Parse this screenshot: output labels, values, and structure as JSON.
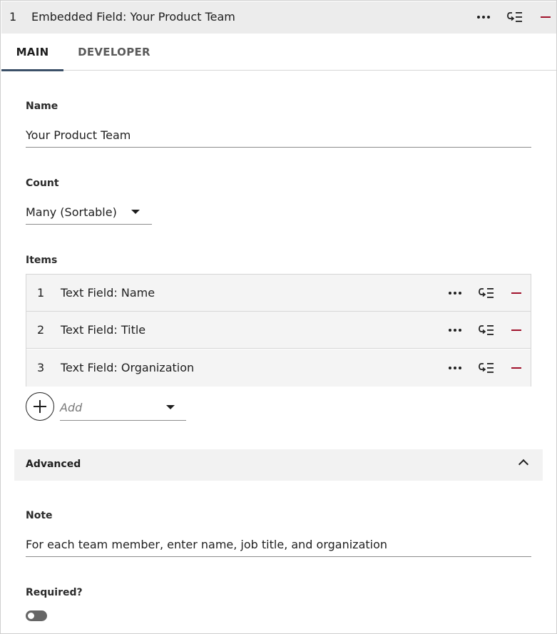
{
  "header": {
    "index": "1",
    "title": "Embedded Field: Your Product Team"
  },
  "tabs": [
    {
      "label": "MAIN",
      "active": true
    },
    {
      "label": "DEVELOPER",
      "active": false
    }
  ],
  "fields": {
    "name": {
      "label": "Name",
      "value": "Your Product Team"
    },
    "count": {
      "label": "Count",
      "value": "Many (Sortable)"
    },
    "items_label": "Items",
    "items": [
      {
        "index": "1",
        "label": "Text Field: Name"
      },
      {
        "index": "2",
        "label": "Text Field: Title"
      },
      {
        "index": "3",
        "label": "Text Field: Organization"
      }
    ],
    "add": {
      "placeholder": "Add"
    }
  },
  "advanced": {
    "label": "Advanced",
    "expanded": true,
    "note": {
      "label": "Note",
      "value": "For each team member, enter name, job title, and organization"
    },
    "required": {
      "label": "Required?",
      "on": false
    }
  },
  "colors": {
    "header_bg": "#ececec",
    "remove_icon": "#a0112b",
    "tab_indicator": "#3b5068"
  }
}
